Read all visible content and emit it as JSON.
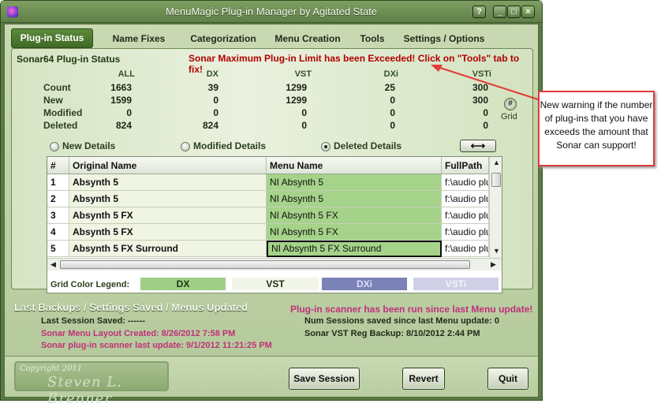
{
  "window": {
    "title": "MenuMagic Plug-in Manager by Agitated State",
    "buttons": {
      "help": "?",
      "minimize": "_",
      "maximize": "□",
      "close": "×"
    }
  },
  "tabs": [
    "Plug-in Status",
    "Name Fixes",
    "Categorization",
    "Menu Creation",
    "Tools",
    "Settings / Options"
  ],
  "status": {
    "title": "Sonar64 Plug-in Status",
    "limit_warning": "Sonar Maximum Plug-in Limit has been Exceeded!  Click on \"Tools\" tab to fix!",
    "columns": [
      "ALL",
      "DX",
      "VST",
      "DXi",
      "VSTi"
    ],
    "rows": [
      {
        "label": "Count",
        "values": [
          "1663",
          "39",
          "1299",
          "25",
          "300"
        ]
      },
      {
        "label": "New",
        "values": [
          "1599",
          "0",
          "1299",
          "0",
          "300"
        ]
      },
      {
        "label": "Modified",
        "values": [
          "0",
          "0",
          "0",
          "0",
          "0"
        ]
      },
      {
        "label": "Deleted",
        "values": [
          "824",
          "824",
          "0",
          "0",
          "0"
        ]
      }
    ],
    "grid_button_label": "Grid",
    "grid_button_icon": "#"
  },
  "details": {
    "options": [
      "New Details",
      "Modified Details",
      "Deleted Details"
    ],
    "selected": "Deleted Details",
    "swap_icon": "⟷"
  },
  "grid": {
    "headers": [
      "#",
      "Original Name",
      "Menu Name",
      "FullPath"
    ],
    "rows": [
      {
        "num": "1",
        "original": "Absynth 5",
        "menu": "NI Absynth 5",
        "path": "f:\\audio plu"
      },
      {
        "num": "2",
        "original": "Absynth 5",
        "menu": "NI Absynth 5",
        "path": "f:\\audio plu"
      },
      {
        "num": "3",
        "original": "Absynth 5 FX",
        "menu": "NI Absynth 5 FX",
        "path": "f:\\audio plu"
      },
      {
        "num": "4",
        "original": "Absynth 5 FX",
        "menu": "NI Absynth 5 FX",
        "path": "f:\\audio plu"
      },
      {
        "num": "5",
        "original": "Absynth 5 FX Surround",
        "menu": "NI Absynth 5 FX Surround",
        "path": "f:\\audio plu"
      }
    ]
  },
  "legend": {
    "label": "Grid Color Legend:",
    "items": [
      {
        "name": "DX",
        "color": "#9fcf87"
      },
      {
        "name": "VST",
        "color": "#f2f6e8"
      },
      {
        "name": "DXi",
        "color": "#7a82b8"
      },
      {
        "name": "VSTi",
        "color": "#cfcfe6"
      }
    ]
  },
  "backups": {
    "title": "Last Backups / Settings Saved / Menus Updated",
    "scanner_warning": "Plug-in scanner has been run since last Menu update!",
    "last_session": "Last Session Saved: ------",
    "menu_layout": "Sonar Menu Layout Created: 8/26/2012 7:58 PM",
    "scanner_update": "Sonar plug-in scanner last update: 9/1/2012 11:21:25 PM",
    "num_sessions": "Num Sessions saved since last Menu update: 0",
    "vst_backup": "Sonar VST Reg Backup: 8/10/2012 2:44 PM"
  },
  "footer": {
    "copyright_small": "Copyright 2011",
    "copyright_name": "Steven L. Brenner",
    "buttons": {
      "save": "Save Session",
      "revert": "Revert",
      "quit": "Quit"
    }
  },
  "callout": {
    "text": "New warning if the number of plug-ins that you have exceeds the amount that Sonar can support!",
    "border_color": "#e23a3a"
  }
}
